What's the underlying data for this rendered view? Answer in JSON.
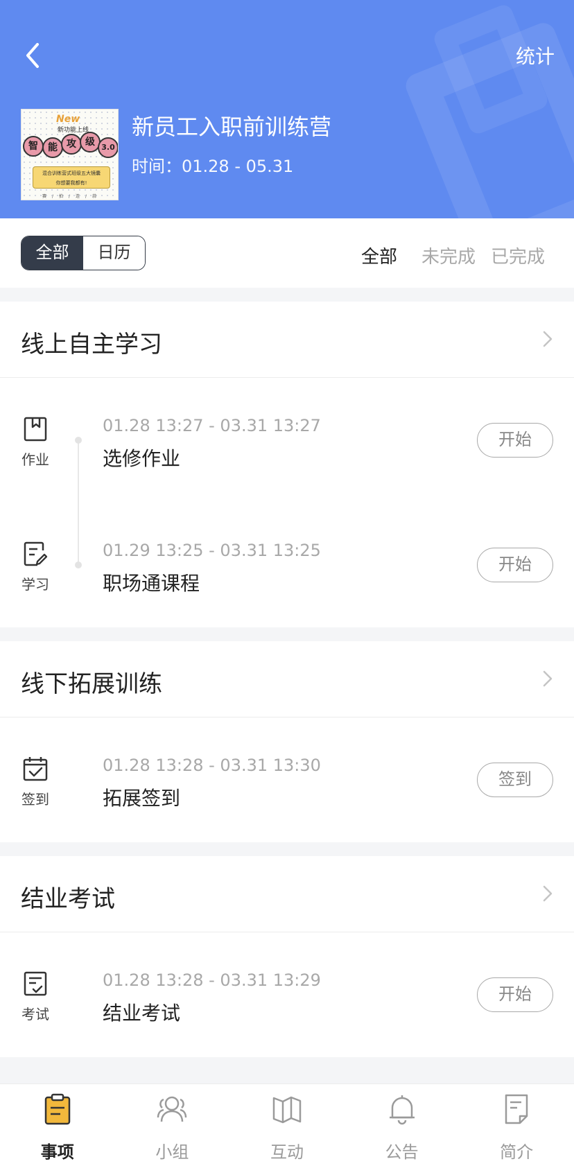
{
  "header": {
    "stats_label": "统计",
    "title": "新员工入职前训练营",
    "time": "时间：01.28 - 05.31",
    "cover": {
      "new_tag": "New",
      "tagline": "新功能上线",
      "balls": [
        "智",
        "能",
        "攻",
        "级",
        "3.0"
      ],
      "box_line1": "混合训练营式班级五大镜囊",
      "box_line2": "你想要我都有!",
      "bottom": "赛/拍/连/蒜"
    }
  },
  "filter": {
    "view_all": "全部",
    "view_calendar": "日历",
    "status_all": "全部",
    "status_incomplete": "未完成",
    "status_complete": "已完成"
  },
  "sections": [
    {
      "title": "线上自主学习",
      "tasks": [
        {
          "icon": "bookmark-icon",
          "label": "作业",
          "time": "01.28 13:27 - 03.31 13:27",
          "name": "选修作业",
          "action": "开始"
        },
        {
          "icon": "edit-doc-icon",
          "label": "学习",
          "time": "01.29 13:25 - 03.31 13:25",
          "name": "职场通课程",
          "action": "开始"
        }
      ]
    },
    {
      "title": "线下拓展训练",
      "tasks": [
        {
          "icon": "calendar-check-icon",
          "label": "签到",
          "time": "01.28 13:28 - 03.31 13:30",
          "name": "拓展签到",
          "action": "签到"
        }
      ]
    },
    {
      "title": "结业考试",
      "tasks": [
        {
          "icon": "exam-icon",
          "label": "考试",
          "time": "01.28 13:28 - 03.31 13:29",
          "name": "结业考试",
          "action": "开始"
        }
      ]
    }
  ],
  "tabbar": {
    "items": [
      {
        "label": "事项",
        "icon": "clipboard-icon",
        "active": true
      },
      {
        "label": "小组",
        "icon": "group-icon",
        "active": false
      },
      {
        "label": "互动",
        "icon": "map-icon",
        "active": false
      },
      {
        "label": "公告",
        "icon": "bell-icon",
        "active": false
      },
      {
        "label": "简介",
        "icon": "document-icon",
        "active": false
      }
    ]
  },
  "colors": {
    "header_bg": "#5f8af0",
    "segment_active": "#343c4a",
    "tab_active_icon": "#f2b83c"
  }
}
